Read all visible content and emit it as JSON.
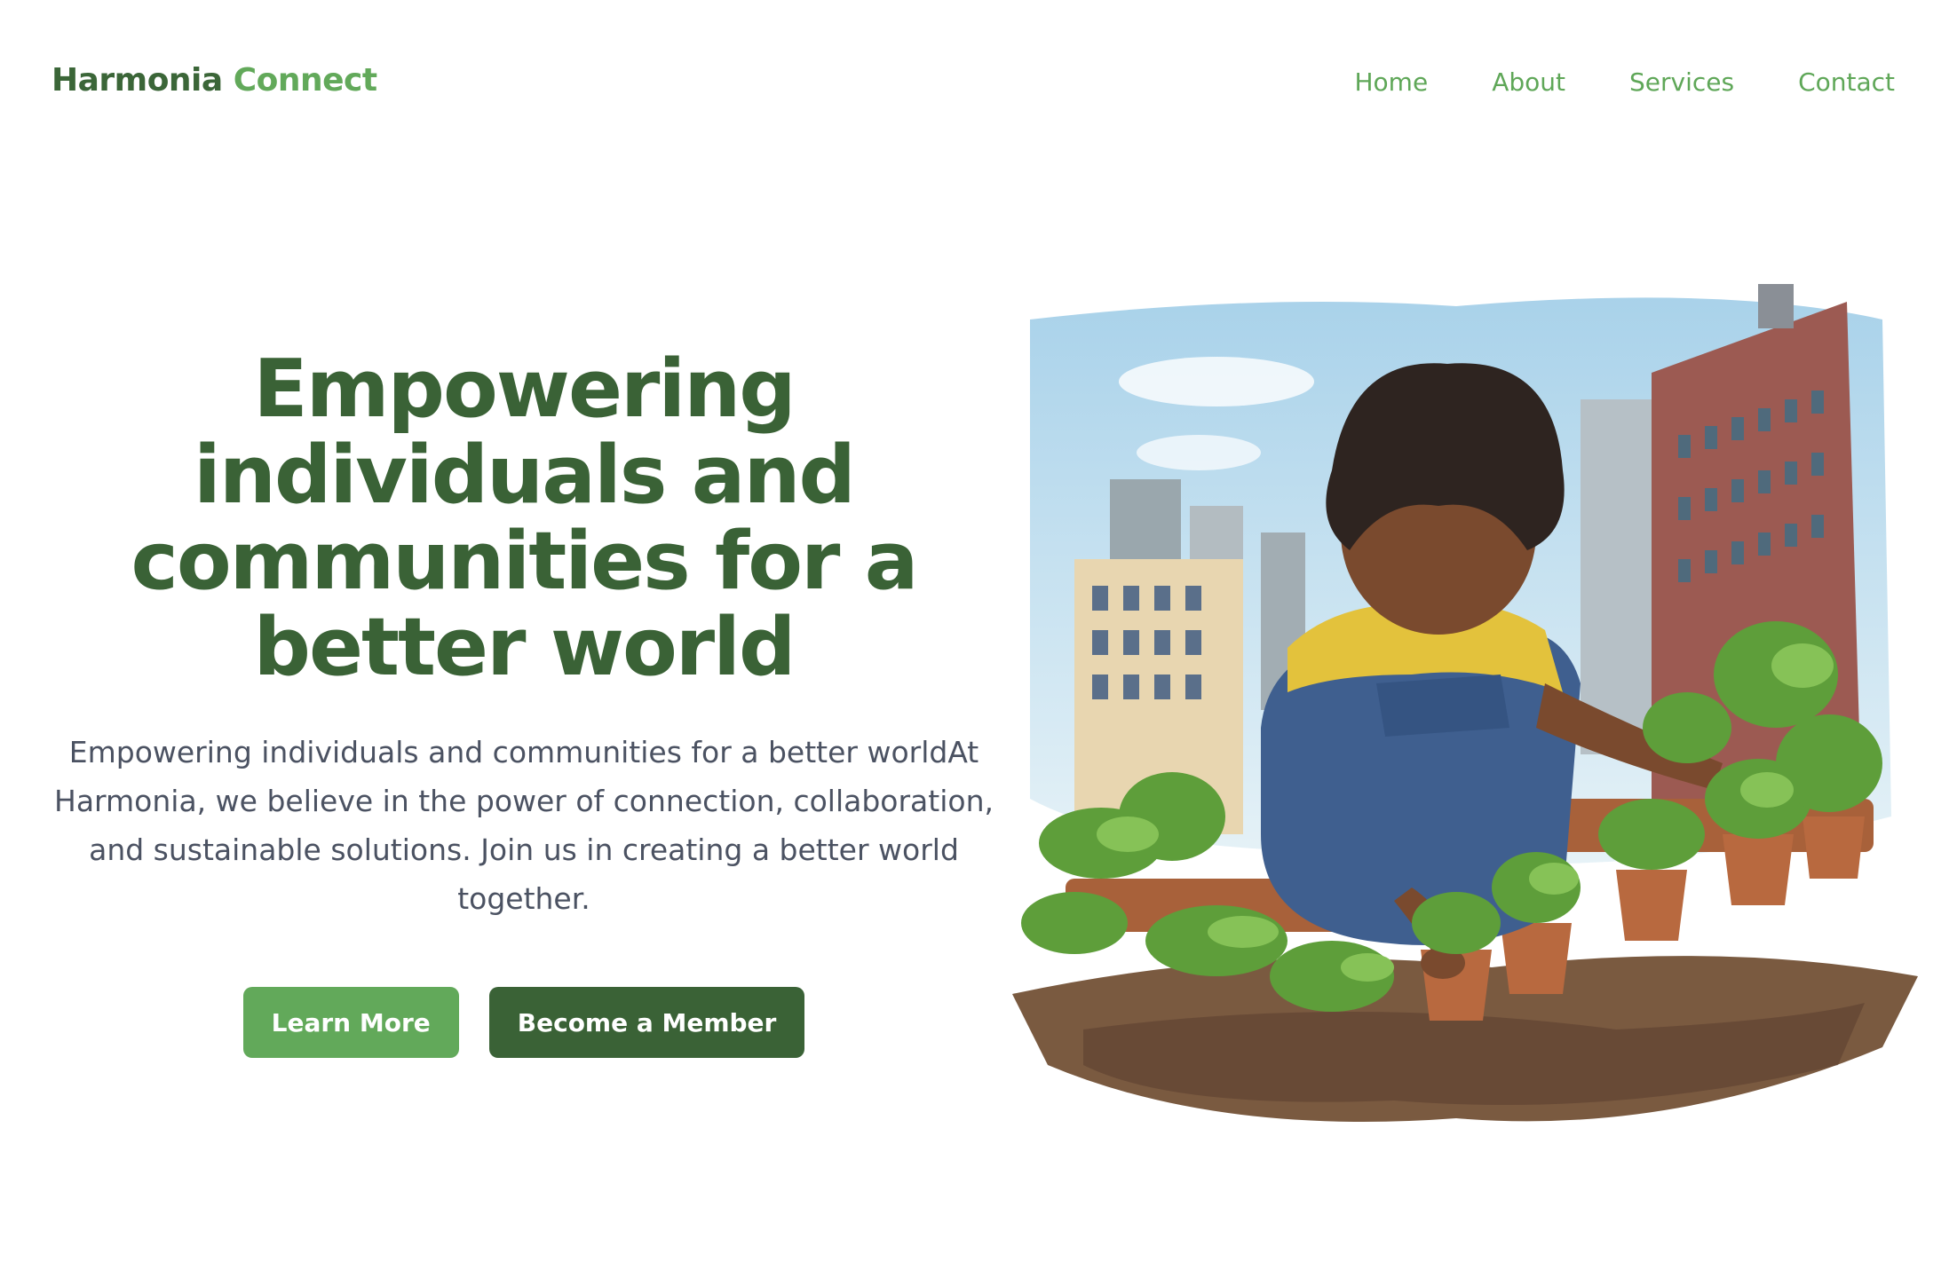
{
  "brand": {
    "name_part1": "Harmonia",
    "name_part2": "Connect"
  },
  "nav": {
    "items": [
      "Home",
      "About",
      "Services",
      "Contact"
    ]
  },
  "hero": {
    "title": "Empowering individuals and communities for a better world",
    "subtitle": "Empowering individuals and communities for a better worldAt Harmonia, we believe in the power of connection, collaboration, and sustainable solutions. Join us in creating a better world together.",
    "primary_button": "Learn More",
    "secondary_button": "Become a Member"
  },
  "colors": {
    "brand_dark": "#3a6236",
    "brand_light": "#62a95a",
    "body_text": "#4b5262"
  }
}
